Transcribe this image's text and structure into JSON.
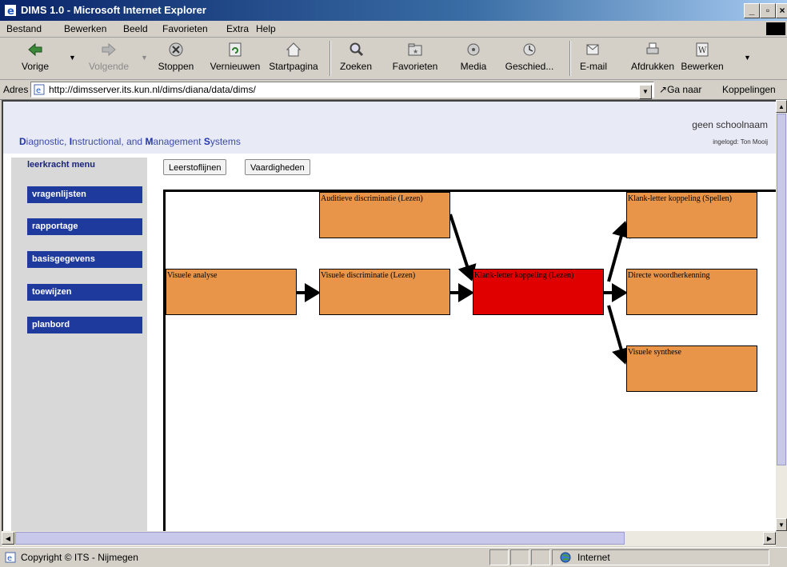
{
  "window": {
    "title": "DIMS 1.0 - Microsoft Internet Explorer"
  },
  "menu": [
    "Bestand",
    "Bewerken",
    "Beeld",
    "Favorieten",
    "Extra",
    "Help"
  ],
  "toolbar": {
    "back": "Vorige",
    "forward": "Volgende",
    "stop": "Stoppen",
    "refresh": "Vernieuwen",
    "home": "Startpagina",
    "search": "Zoeken",
    "favorites": "Favorieten",
    "media": "Media",
    "history": "Geschied...",
    "mail": "E-mail",
    "print": "Afdrukken",
    "edit": "Bewerken"
  },
  "address": {
    "label": "Adres",
    "url": "http://dimsserver.its.kun.nl/dims/diana/data/dims/",
    "go": "Ga naar",
    "links": "Koppelingen"
  },
  "page": {
    "school": "geen schoolnaam",
    "logged_in": "ingelogd: Ton Mooij",
    "brand": {
      "d": "D",
      "d_rest": "iagnostic, ",
      "i": "I",
      "i_rest": "nstructional, and ",
      "m": "M",
      "m_rest": "anagement ",
      "s": "S",
      "s_rest": "ystems"
    }
  },
  "sidebar": {
    "title": "leerkracht menu",
    "items": [
      "vragenlijsten",
      "rapportage",
      "basisgegevens",
      "toewijzen",
      "planbord"
    ]
  },
  "tabs": [
    "Leerstoflijnen",
    "Vaardigheden"
  ],
  "diagram": {
    "nodes": [
      "Auditieve discriminatie (Lezen)",
      "Klank-letter koppeling (Spellen)",
      "Visuele analyse",
      "Visuele discriminatie (Lezen)",
      "Klank-letter koppeling (Lezen)",
      "Directe woordherkenning",
      "Visuele synthese"
    ],
    "active_node": "Klank-letter koppeling (Lezen)",
    "colors": {
      "node": "#e8954a",
      "active": "#e00000"
    }
  },
  "status": {
    "text": "Copyright © ITS - Nijmegen",
    "zone": "Internet"
  }
}
